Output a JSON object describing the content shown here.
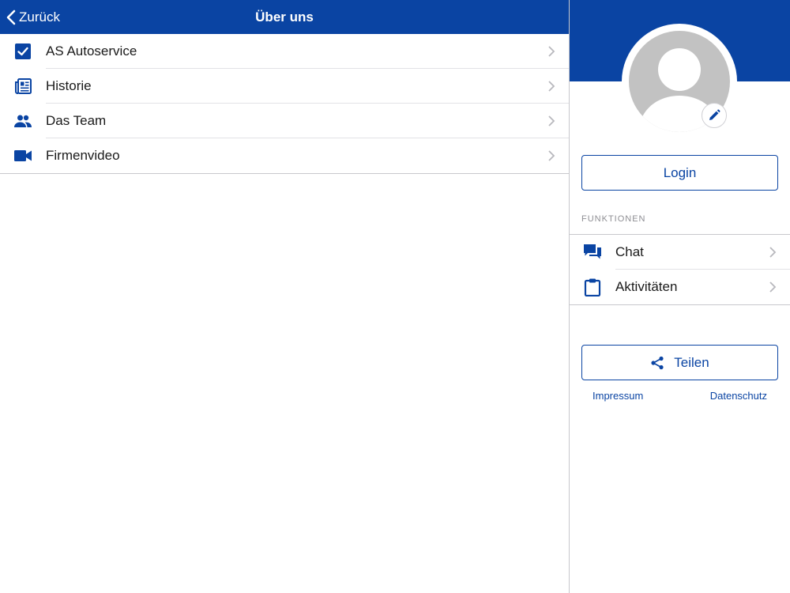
{
  "colors": {
    "brand": "#0a44a3",
    "chevron": "#b8b8bd",
    "avatar": "#c2c2c2"
  },
  "navbar": {
    "back_label": "Zurück",
    "title": "Über uns"
  },
  "menu": {
    "items": [
      {
        "label": "AS Autoservice",
        "icon": "checkbox-icon"
      },
      {
        "label": "Historie",
        "icon": "newspaper-icon"
      },
      {
        "label": "Das Team",
        "icon": "people-icon"
      },
      {
        "label": "Firmenvideo",
        "icon": "video-camera-icon"
      }
    ]
  },
  "sidebar": {
    "login_label": "Login",
    "section_title": "FUNKTIONEN",
    "functions": [
      {
        "label": "Chat",
        "icon": "chat-bubbles-icon"
      },
      {
        "label": "Aktivitäten",
        "icon": "clipboard-icon"
      }
    ],
    "share_label": "Teilen",
    "links": {
      "impressum": "Impressum",
      "datenschutz": "Datenschutz"
    }
  }
}
